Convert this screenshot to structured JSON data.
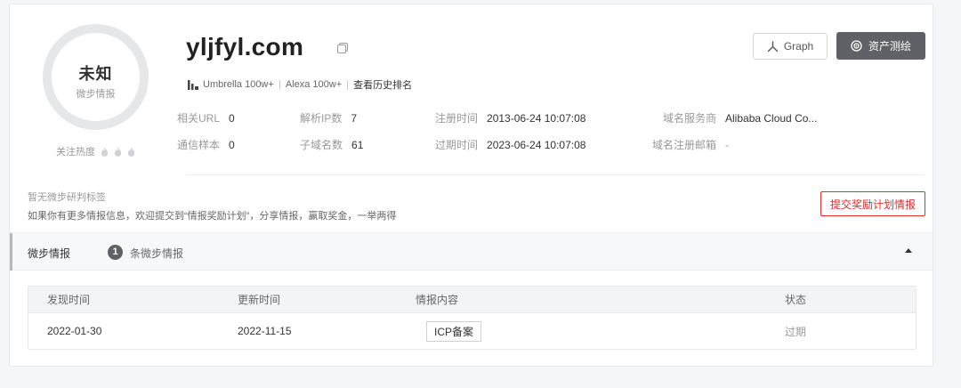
{
  "gauge": {
    "title": "未知",
    "subtitle": "微步情报"
  },
  "heat": {
    "label": "关注热度",
    "flames": 3,
    "flame_color": "#d0d2d6"
  },
  "domain": "yljfyl.com",
  "rank": {
    "umbrella_label": "Umbrella",
    "umbrella_value": "100w+",
    "alexa_label": "Alexa",
    "alexa_value": "100w+",
    "history_link": "查看历史排名"
  },
  "buttons": {
    "graph": "Graph",
    "asset_map": "资产测绘"
  },
  "info": {
    "related_url_label": "相关URL",
    "related_url_value": "0",
    "resolved_ip_label": "解析IP数",
    "resolved_ip_value": "7",
    "reg_time_label": "注册时间",
    "reg_time_value": "2013-06-24 10:07:08",
    "registrar_label": "域名服务商",
    "registrar_value": "Alibaba Cloud Co...",
    "comm_samples_label": "通信样本",
    "comm_samples_value": "0",
    "subdomains_label": "子域名数",
    "subdomains_value": "61",
    "expire_time_label": "过期时间",
    "expire_time_value": "2023-06-24 10:07:08",
    "reg_email_label": "域名注册邮箱",
    "reg_email_value": "-"
  },
  "tags": {
    "empty_text": "暂无微步研判标签",
    "tip_text": "如果你有更多情报信息，欢迎提交到“情报奖励计划”，分享情报，赢取奖金，一举两得",
    "submit_button": "提交奖励计划情报"
  },
  "section": {
    "title": "微步情报",
    "count": "1",
    "count_label": "条微步情报"
  },
  "table": {
    "headers": [
      "发现时间",
      "更新时间",
      "情报内容",
      "状态"
    ],
    "rows": [
      {
        "found": "2022-01-30",
        "updated": "2022-11-15",
        "content": "ICP备案",
        "status": "过期"
      }
    ]
  },
  "colors": {
    "accent_red": "#e02d2d",
    "dark_button": "#5f6166"
  }
}
